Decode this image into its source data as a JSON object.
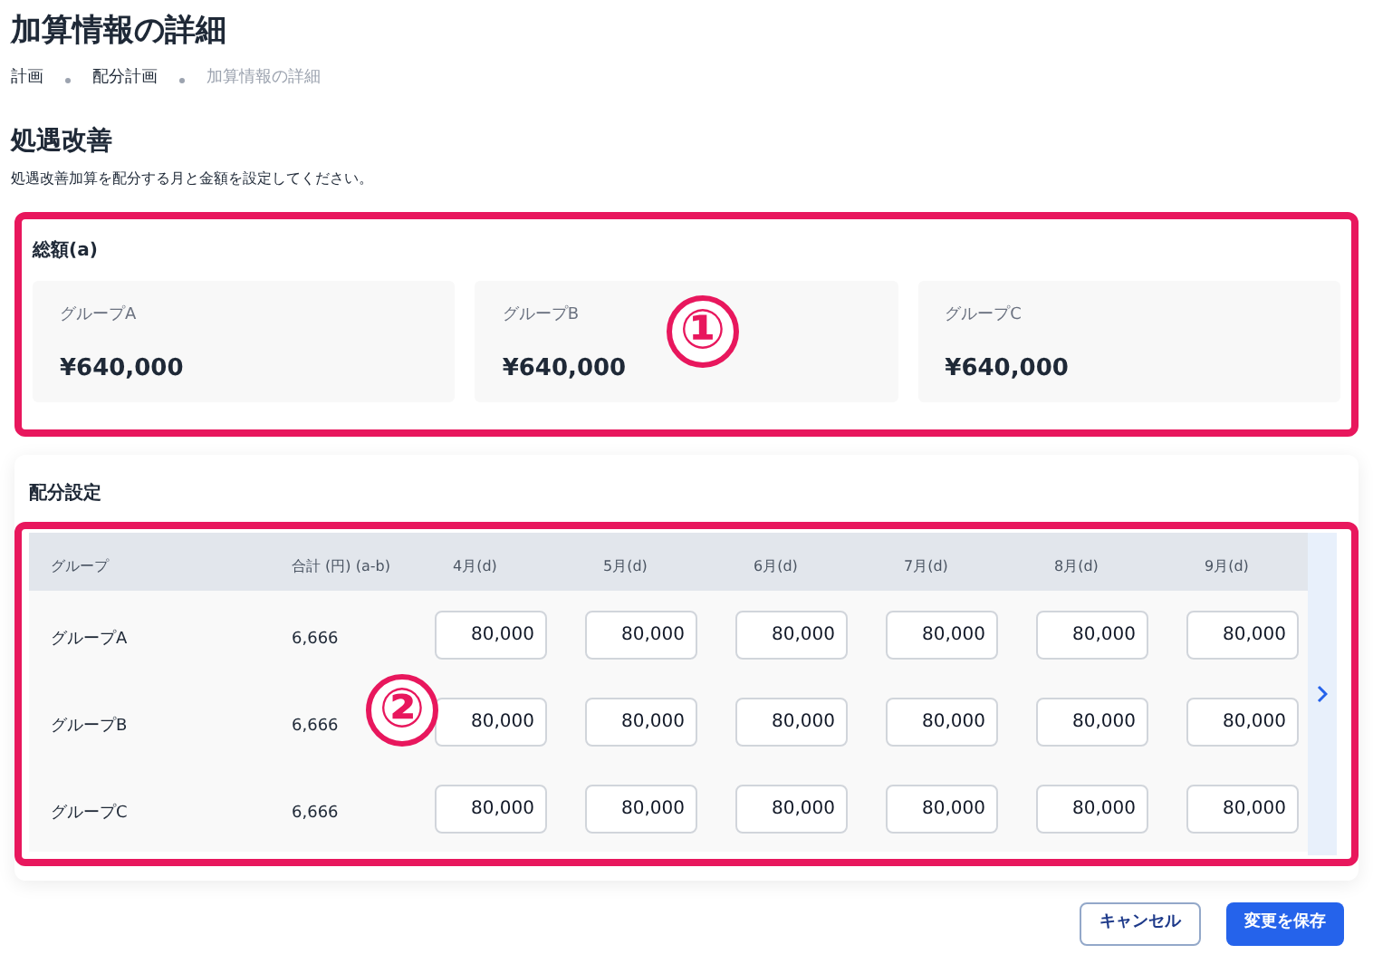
{
  "page_title": "加算情報の詳細",
  "breadcrumb": [
    {
      "label": "計画",
      "current": false
    },
    {
      "label": "配分計画",
      "current": false
    },
    {
      "label": "加算情報の詳細",
      "current": true
    }
  ],
  "section": {
    "title": "処遇改善",
    "description": "処遇改善加算を配分する月と金額を設定してください。"
  },
  "totals": {
    "title": "総額(a)",
    "callout": "①",
    "cards": [
      {
        "label": "グループA",
        "amount": "¥640,000"
      },
      {
        "label": "グループB",
        "amount": "¥640,000"
      },
      {
        "label": "グループC",
        "amount": "¥640,000"
      }
    ]
  },
  "allocation": {
    "title": "配分設定",
    "callout": "②",
    "columns": [
      "グループ",
      "合計 (円) (a-b)",
      "4月(d)",
      "5月(d)",
      "6月(d)",
      "7月(d)",
      "8月(d)",
      "9月(d)"
    ],
    "rows": [
      {
        "group": "グループA",
        "total": "6,666",
        "values": [
          "80,000",
          "80,000",
          "80,000",
          "80,000",
          "80,000",
          "80,000"
        ]
      },
      {
        "group": "グループB",
        "total": "6,666",
        "values": [
          "80,000",
          "80,000",
          "80,000",
          "80,000",
          "80,000",
          "80,000"
        ]
      },
      {
        "group": "グループC",
        "total": "6,666",
        "values": [
          "80,000",
          "80,000",
          "80,000",
          "80,000",
          "80,000",
          "80,000"
        ]
      }
    ]
  },
  "buttons": [
    {
      "label": "キャンセル",
      "kind": "secondary"
    },
    {
      "label": "変更を保存",
      "kind": "primary"
    }
  ]
}
